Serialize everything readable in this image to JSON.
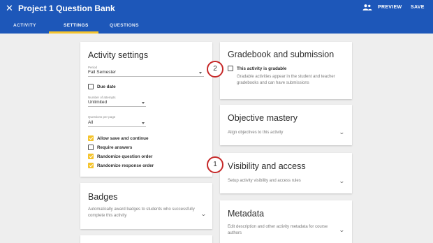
{
  "header": {
    "title": "Project 1 Question Bank",
    "close_icon": "close-icon",
    "people_icon": "people-icon",
    "preview_label": "PREVIEW",
    "save_label": "SAVE",
    "background": "#1d57b9",
    "accent": "#f5c42c"
  },
  "tabs": [
    {
      "label": "ACTIVITY",
      "active": false
    },
    {
      "label": "SETTINGS",
      "active": true
    },
    {
      "label": "QUESTIONS",
      "active": false
    }
  ],
  "activity_settings": {
    "title": "Activity settings",
    "period": {
      "label": "Period",
      "value": "Fall Semester"
    },
    "due_date": {
      "label": "Due date",
      "checked": false
    },
    "attempts": {
      "label": "Number of attempts",
      "value": "Unlimited"
    },
    "questions_per_page": {
      "label": "Questions per page",
      "value": "All"
    },
    "options": [
      {
        "label": "Allow save and continue",
        "checked": true
      },
      {
        "label": "Require answers",
        "checked": false
      },
      {
        "label": "Randomize question order",
        "checked": true
      },
      {
        "label": "Randomize response order",
        "checked": true
      }
    ]
  },
  "badges": {
    "title": "Badges",
    "description": "Automatically award badges to students who successfully complete this activity"
  },
  "gradebook": {
    "title": "Gradebook and submission",
    "checkbox_label": "This activity is gradable",
    "checked": false,
    "description": "Gradable activities appear in the student and teacher gradebooks and can have submissions"
  },
  "objective_mastery": {
    "title": "Objective mastery",
    "description": "Align objectives to this activity"
  },
  "visibility": {
    "title": "Visibility and access",
    "description": "Setup activity visibility and access rules"
  },
  "metadata": {
    "title": "Metadata",
    "description": "Edit description and other activity metadata for course authors"
  },
  "markers": [
    {
      "number": "1"
    },
    {
      "number": "2"
    }
  ]
}
